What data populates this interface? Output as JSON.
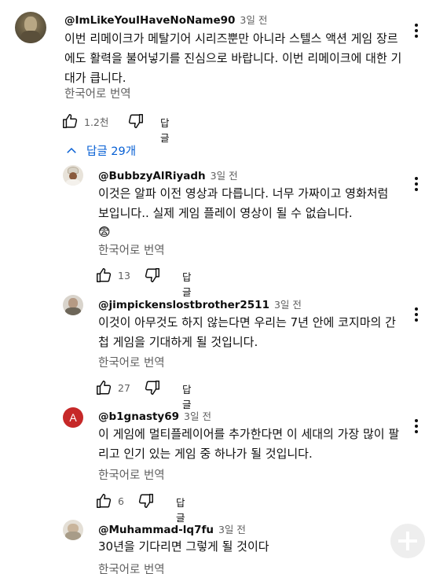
{
  "top_comment": {
    "handle": "@ImLikeYouIHaveNoName90",
    "time": "3일 전",
    "text": "이번 리메이크가 메탈기어 시리즈뿐만 아니라 스텔스 액션 게임 장르에도 활력을 불어넣기를 진심으로 바랍니다. 이번 리메이크에 대한 기대가 큽니다.",
    "translate": "한국어로 번역",
    "likes": "1.2천",
    "reply_label": "답글"
  },
  "replies_toggle": {
    "label": "답글 29개"
  },
  "replies": [
    {
      "handle": "@BubbzyAlRiyadh",
      "time": "3일 전",
      "text": "이것은 알파 이전 영상과 다릅니다. 너무 가짜이고 영화처럼 보입니다.. 실제 게임 플레이 영상이 될 수 없습니다.",
      "emoji": "😨",
      "translate": "한국어로 번역",
      "likes": "13",
      "reply_label": "답글"
    },
    {
      "handle": "@jimpickenslostbrother2511",
      "time": "3일 전",
      "text": "이것이 아무것도 하지 않는다면 우리는 7년 안에 코지마의 간첩 게임을 기대하게 될 것입니다.",
      "translate": "한국어로 번역",
      "likes": "27",
      "reply_label": "답글"
    },
    {
      "handle": "@b1gnasty69",
      "time": "3일 전",
      "avatar_letter": "A",
      "text": "이 게임에 멀티플레이어를 추가한다면 이 세대의 가장 많이 팔리고 인기 있는 게임 중 하나가 될 것입니다.",
      "translate": "한국어로 번역",
      "likes": "6",
      "reply_label": "답글"
    },
    {
      "handle": "@Muhammad-lq7fu",
      "time": "3일 전",
      "text": "30년을 기다리면 그렇게 될 것이다",
      "translate": "한국어로 번역"
    }
  ],
  "colors": {
    "link_blue": "#065fd4",
    "secondary_text": "#606060",
    "avatar_red": "#c62828"
  },
  "icons": [
    "thumbs-up-icon",
    "thumbs-down-icon",
    "chevron-up-icon",
    "more-vert-icon"
  ]
}
